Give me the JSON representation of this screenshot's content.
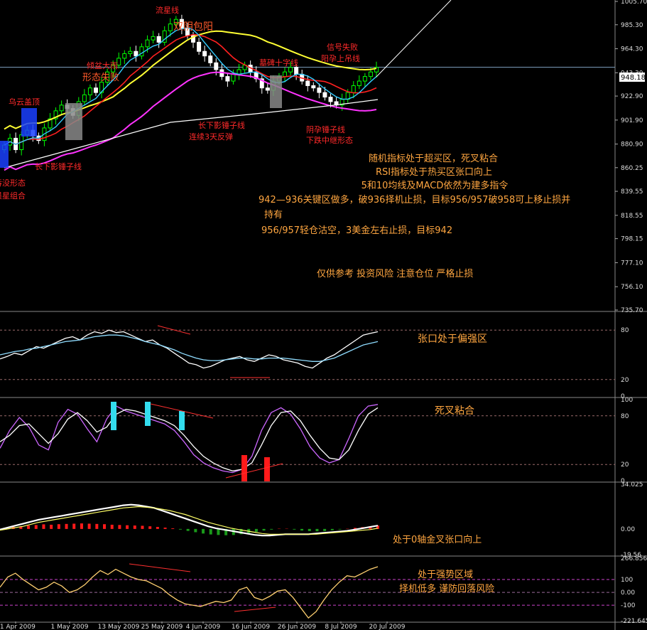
{
  "chart_data": [
    {
      "type": "candlestick",
      "panel": "price",
      "ylim": [
        735.7,
        1005.7
      ],
      "y_ticks": [
        "1005.70",
        "985.30",
        "964.30",
        "943.30",
        "922.90",
        "901.90",
        "880.90",
        "860.25",
        "839.55",
        "818.55",
        "798.15",
        "777.10",
        "756.10",
        "735.70"
      ],
      "current_price": "948.18",
      "x_ticks": [
        "21 Apr 2009",
        "1 May 2009",
        "13 May 2009",
        "25 May 2009",
        "4 Jun 2009",
        "16 Jun 2009",
        "26 Jun 2009",
        "8 Jul 2009",
        "20 Jul 2009"
      ],
      "close_series": [
        880,
        886,
        876,
        889,
        893,
        888,
        884,
        895,
        903,
        910,
        915,
        912,
        906,
        918,
        924,
        930,
        926,
        935,
        944,
        950,
        956,
        960,
        962,
        958,
        966,
        972,
        975,
        970,
        980,
        986,
        990,
        982,
        976,
        970,
        962,
        958,
        952,
        946,
        940,
        936,
        942,
        946,
        950,
        944,
        938,
        930,
        928,
        936,
        940,
        944,
        948,
        942,
        936,
        932,
        930,
        926,
        922,
        918,
        915,
        920,
        926,
        932,
        936,
        940,
        944,
        948
      ],
      "annotations": [
        "流星线",
        "双阴包阳",
        "倾盆大雨",
        "形态失败",
        "乌云盖顶",
        "长下影锤子线",
        "吞没形态",
        "晨星组合",
        "长下影锤子线",
        "连续3天反弹",
        "墓碑十字线",
        "信号失败",
        "阳孕上吊线",
        "阴孕锤子线",
        "下跌中继形态"
      ]
    },
    {
      "type": "line",
      "panel": "rsi",
      "ylim": [
        0,
        100
      ],
      "y_ticks": [
        "80",
        "20",
        "0"
      ],
      "levels": [
        80,
        20
      ],
      "series": [
        {
          "color": "#ffffff",
          "values": [
            45,
            48,
            52,
            50,
            55,
            60,
            58,
            62,
            66,
            70,
            72,
            68,
            74,
            78,
            76,
            80,
            77,
            78,
            74,
            70,
            66,
            68,
            62,
            58,
            52,
            46,
            40,
            38,
            34,
            36,
            40,
            44,
            46,
            48,
            44,
            42,
            46,
            50,
            48,
            44,
            42,
            40,
            36,
            34,
            40,
            46,
            50,
            56,
            62,
            68,
            74,
            76,
            78
          ]
        },
        {
          "color": "#8fdcff",
          "values": [
            50,
            52,
            54,
            55,
            57,
            58,
            60,
            62,
            64,
            66,
            67,
            68,
            70,
            72,
            73,
            74,
            74,
            73,
            71,
            69,
            66,
            64,
            62,
            59,
            56,
            52,
            49,
            46,
            44,
            43,
            43,
            44,
            45,
            46,
            46,
            45,
            45,
            46,
            46,
            46,
            45,
            44,
            43,
            42,
            42,
            44,
            46,
            50,
            54,
            58,
            62,
            64,
            66
          ]
        }
      ],
      "annotations": [
        "张口处于偏强区"
      ]
    },
    {
      "type": "line",
      "panel": "stochastic",
      "ylim": [
        0,
        100
      ],
      "y_ticks": [
        "100",
        "80",
        "20",
        "0"
      ],
      "levels": [
        80,
        20
      ],
      "series": [
        {
          "color": "#cc66ff",
          "values": [
            40,
            62,
            78,
            66,
            44,
            38,
            72,
            88,
            82,
            64,
            48,
            76,
            92,
            86,
            82,
            78,
            74,
            70,
            62,
            48,
            32,
            22,
            16,
            12,
            10,
            14,
            30,
            62,
            84,
            90,
            82,
            64,
            42,
            28,
            22,
            26,
            52,
            80,
            92,
            94
          ]
        },
        {
          "color": "#ffffff",
          "values": [
            48,
            56,
            68,
            70,
            58,
            46,
            58,
            76,
            84,
            74,
            60,
            66,
            82,
            88,
            86,
            82,
            78,
            74,
            68,
            56,
            42,
            30,
            22,
            16,
            12,
            14,
            22,
            44,
            68,
            84,
            86,
            74,
            56,
            40,
            28,
            26,
            38,
            62,
            82,
            90
          ]
        }
      ],
      "annotations": [
        "死叉粘合"
      ]
    },
    {
      "type": "bar",
      "panel": "macd",
      "ylim": [
        -19.56,
        34.025
      ],
      "y_ticks": [
        "34.025",
        "0.00",
        "-19.56"
      ],
      "histogram": [
        1,
        1.5,
        2,
        2.5,
        3,
        3.5,
        3.2,
        3.6,
        3.8,
        4,
        4.2,
        4,
        3.8,
        3.6,
        3.2,
        3,
        2.8,
        2.6,
        2.4,
        2,
        1.5,
        1,
        0.5,
        -0.5,
        -1.5,
        -2.5,
        -3.5,
        -4.2,
        -4.6,
        -4.8,
        -4.6,
        -4,
        -3.2,
        -2.2,
        -1.2,
        -0.5,
        0.2,
        0.2,
        -0.5,
        -1.2,
        -1.6,
        -1.8,
        -1.6,
        -1,
        -0.4,
        0.2,
        0.8,
        1.4,
        2,
        2.6
      ],
      "series": [
        {
          "color": "#ffffff",
          "values": [
            -0.5,
            1,
            2.5,
            4,
            5.5,
            7,
            8,
            9,
            10,
            11,
            12,
            13,
            14,
            15,
            16,
            17,
            18,
            18.5,
            18,
            17,
            16,
            14,
            12,
            10,
            8,
            6,
            4,
            2,
            0.5,
            -0.5,
            -1.5,
            -2.5,
            -3.5,
            -4.5,
            -5,
            -5,
            -4.5,
            -4,
            -4,
            -4,
            -4,
            -3.5,
            -3,
            -2.5,
            -2,
            -1.5,
            -0.5,
            0.5,
            1.5,
            2.5
          ]
        },
        {
          "color": "#ffff66",
          "values": [
            -1,
            0,
            1,
            2,
            3.5,
            5,
            6,
            7,
            8,
            9,
            10,
            11,
            12,
            13,
            14,
            15,
            16,
            16.5,
            17,
            16.5,
            16,
            15,
            14,
            12.5,
            11,
            9,
            7,
            5,
            3.5,
            2,
            0.5,
            -0.5,
            -1.5,
            -2.5,
            -3.5,
            -4,
            -4,
            -4,
            -4,
            -4,
            -4,
            -4,
            -3.5,
            -3,
            -2.5,
            -2,
            -1.5,
            -1,
            -0.5,
            0.5
          ]
        }
      ],
      "annotations": [
        "处于0轴金叉张口向上"
      ]
    },
    {
      "type": "line",
      "panel": "cci",
      "ylim": [
        -221.645,
        266.8569
      ],
      "y_ticks": [
        "266.8569",
        "100",
        "0.00",
        "-100",
        "-221.645"
      ],
      "levels": [
        100,
        0,
        -100
      ],
      "series": [
        {
          "color": "#ffd070",
          "values": [
            40,
            120,
            150,
            100,
            60,
            20,
            40,
            80,
            50,
            0,
            20,
            60,
            120,
            170,
            140,
            180,
            150,
            120,
            100,
            90,
            60,
            30,
            -20,
            -60,
            -90,
            -100,
            -110,
            -90,
            -70,
            -80,
            -60,
            20,
            40,
            -40,
            -60,
            -30,
            10,
            20,
            -40,
            -120,
            -200,
            -150,
            -60,
            20,
            80,
            130,
            120,
            150,
            180,
            200
          ]
        }
      ],
      "annotations": [
        "处于强势区域",
        "择机低多 谨防回落风险"
      ]
    }
  ],
  "commentary": {
    "line1": "随机指标处于超买区，死叉粘合",
    "line2": "RSI指标处于热买区张口向上",
    "line3": "5和10均线及MACD依然为建多指令",
    "line4": "942—936关键区做多，破936择机止损，目标956/957破958可上移止损并",
    "line5": "持有",
    "line6": "956/957轻仓沽空，3美金左右止损，目标942",
    "disclaimer": "仅供参考 投资风险 注意仓位 严格止损"
  },
  "colors": {
    "background": "#000000",
    "grid": "#666666",
    "annotation_red": "#ff2a2a",
    "annotation_orange": "#ffa640",
    "bull_candle": "#00ff00",
    "bear_candle": "#ffffff",
    "ma_yellow": "#ffff33",
    "ma_magenta": "#ff33ff",
    "ma_red": "#ff2020",
    "ma_cyan": "#33ccff",
    "ma_white": "#ffffff"
  }
}
